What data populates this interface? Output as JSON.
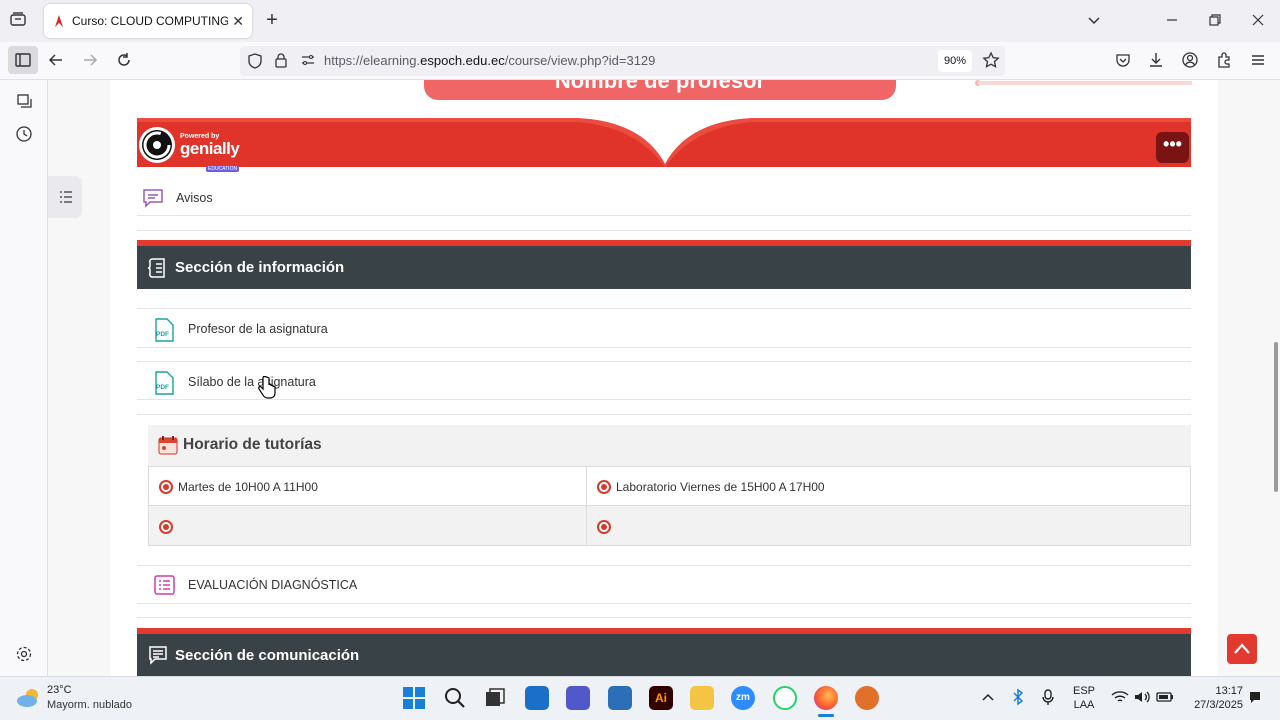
{
  "browser": {
    "tab_title": "Curso: CLOUD COMPUTING | El",
    "tab_close": "✕",
    "new_tab": "+",
    "url_prefix": "https://elearning.",
    "url_domain": "espoch.edu.ec",
    "url_path": "/course/view.php?id=3129",
    "zoom": "90%"
  },
  "page": {
    "top_button_text": "Nombre de profesor",
    "genially": {
      "powered_by": "Powered by",
      "name": "genially",
      "edition": "EDUCATION",
      "menu": "•••"
    },
    "avisos_label": "Avisos",
    "section_info_title": "Sección de información",
    "profesor_label": "Profesor de la asignatura",
    "silabo_label": "Sílabo de la asignatura",
    "tutorias": {
      "title": "Horario de tutorías",
      "cells": [
        "Martes de 10H00 A 11H00",
        "Laboratorio Viernes de 15H00 A 17H00",
        "",
        ""
      ]
    },
    "evaluacion_label": "EVALUACIÓN DIAGNÓSTICA",
    "section_com_title": "Sección de comunicación"
  },
  "taskbar": {
    "weather_temp": "23°C",
    "weather_desc": "Mayorm. nublado",
    "lang_top": "ESP",
    "lang_bottom": "LAA",
    "time": "13:17",
    "date": "27/3/2025"
  },
  "colors": {
    "accent_red": "#e23a2e",
    "section_dark": "#394247",
    "pink_button": "#f06565"
  }
}
